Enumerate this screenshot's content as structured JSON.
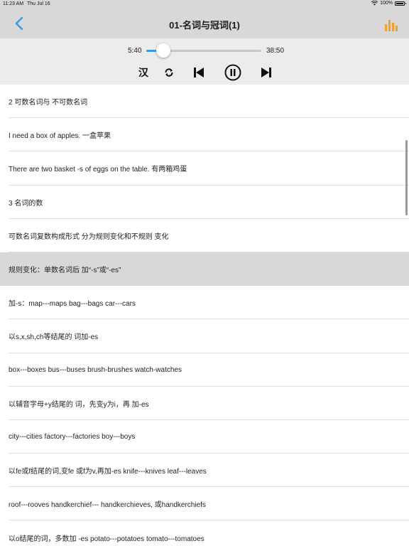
{
  "status_bar": {
    "time": "11:23 AM",
    "date": "Thu Jul 16",
    "battery": "100%"
  },
  "nav": {
    "title": "01-名词与冠词(1)",
    "back_icon": "chevron-left-icon",
    "chart_icon": "bar-chart-icon",
    "accent_color": "#3a9be0",
    "chart_color": "#f0a030"
  },
  "player": {
    "elapsed": "5:40",
    "total": "38:50",
    "progress_fraction": 0.146,
    "lang_toggle": "汉",
    "controls": [
      "repeat-icon",
      "previous-icon",
      "pause-icon",
      "next-icon"
    ]
  },
  "lines": [
    {
      "text": "2 可数名词与 不可数名词",
      "active": false
    },
    {
      "text": "I need a box of apples. 一盒苹果",
      "active": false
    },
    {
      "text": "There are two basket -s of eggs on the table. 有两箱鸡蛋",
      "active": false
    },
    {
      "text": "3 名词的数",
      "active": false
    },
    {
      "text": "可数名词复数构成形式 分为规则变化和不规则 变化",
      "active": false
    },
    {
      "text": "规则变化：单数名词后 加“-s”或“-es”",
      "active": true
    },
    {
      "text": "加-s：map---maps bag---bags car---cars",
      "active": false
    },
    {
      "text": "以s,x,sh,ch等结尾的 词加-es",
      "active": false
    },
    {
      "text": "box---boxes bus---buses brush-brushes watch-watches",
      "active": false
    },
    {
      "text": "以辅音字母+y结尾的 词，先变y为i，再 加-es",
      "active": false
    },
    {
      "text": "city---cities factory---factories boy---boys",
      "active": false
    },
    {
      "text": "以fe或f结尾的词,变fe 或f为v,再加-es knife---knives leaf---leaves",
      "active": false
    },
    {
      "text": "roof---rooves handkerchief--- handkerchieves, 或handkerchiefs",
      "active": false
    },
    {
      "text": "以o结尾的词，多数加 -es potato---potatoes tomato---tomatoes",
      "active": false
    }
  ]
}
